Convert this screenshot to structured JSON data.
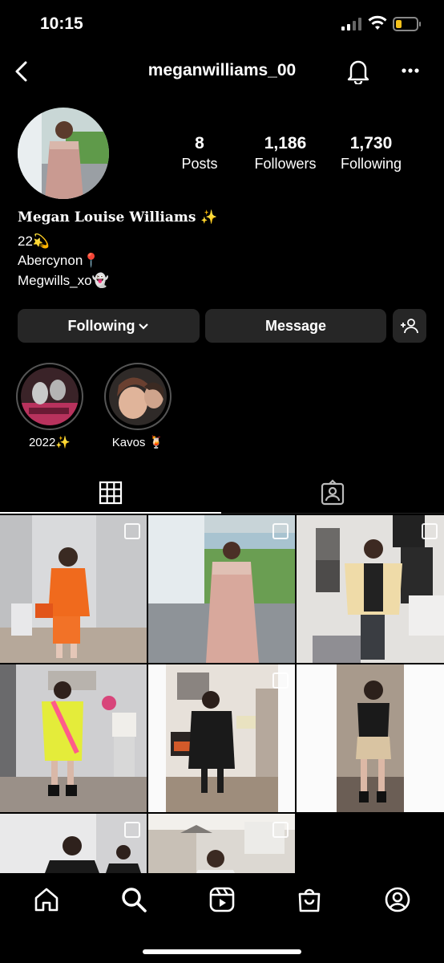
{
  "status_bar": {
    "time": "10:15"
  },
  "header": {
    "username": "meganwilliams_00"
  },
  "profile": {
    "stats": [
      {
        "value": "8",
        "label": "Posts"
      },
      {
        "value": "1,186",
        "label": "Followers"
      },
      {
        "value": "1,730",
        "label": "Following"
      }
    ],
    "full_name": "Megan Louise Williams ✨",
    "bio": [
      "22💫",
      "Abercynon📍",
      "Megwills_xo👻"
    ]
  },
  "actions": {
    "following_label": "Following",
    "message_label": "Message"
  },
  "highlights": [
    {
      "label": "2022✨"
    },
    {
      "label": "Kavos 🍹"
    }
  ],
  "colors": {
    "background": "#000000",
    "button": "#262626",
    "text": "#ffffff"
  },
  "icons": [
    "back-icon",
    "bell-icon",
    "more-icon",
    "grid-icon",
    "tagged-icon",
    "home-icon",
    "search-icon",
    "reels-icon",
    "shop-icon",
    "profile-icon"
  ]
}
